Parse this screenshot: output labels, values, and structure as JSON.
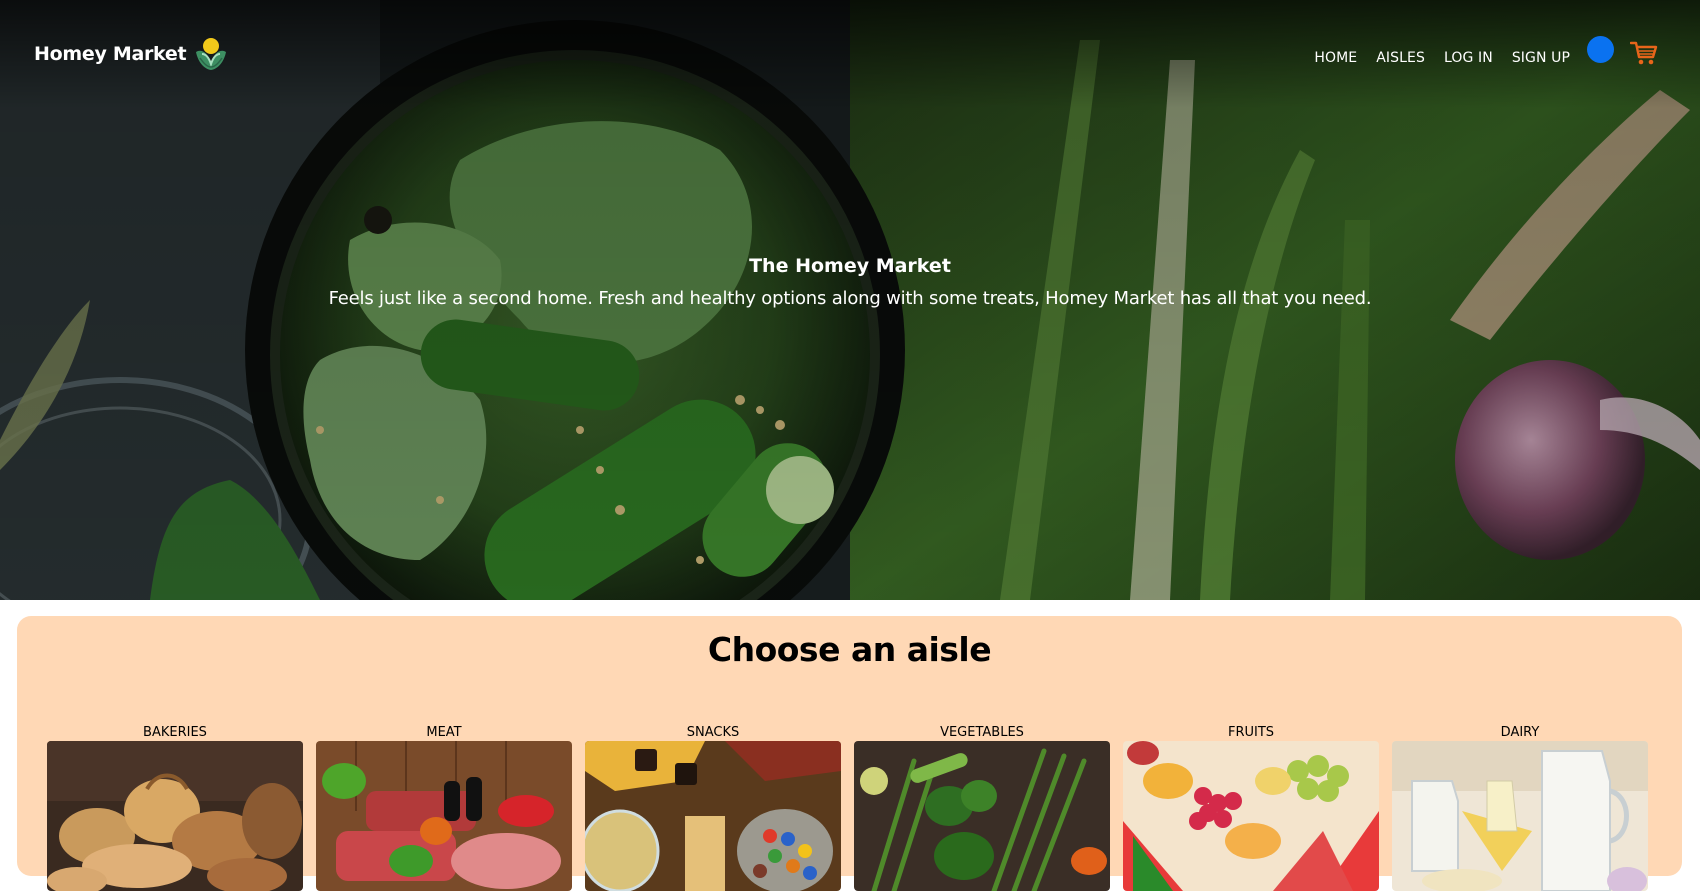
{
  "brand": {
    "name": "Homey Market",
    "logo_icon": "leaf-hands-logo-icon"
  },
  "nav": {
    "links": [
      {
        "label": "HOME"
      },
      {
        "label": "AISLES"
      },
      {
        "label": "LOG IN"
      },
      {
        "label": "SIGN UP"
      }
    ],
    "avatar_color": "#0a72f0",
    "cart_icon": "cart-icon",
    "cart_color": "#e8651a"
  },
  "hero": {
    "title": "The Homey Market",
    "subtitle": "Feels just like a second home. Fresh and healthy options along with some treats, Homey Market has all that you need."
  },
  "aisles": {
    "heading": "Choose an aisle",
    "panel_color": "#ffd8b5",
    "items": [
      {
        "label": "BAKERIES"
      },
      {
        "label": "MEAT"
      },
      {
        "label": "SNACKS"
      },
      {
        "label": "VEGETABLES"
      },
      {
        "label": "FRUITS"
      },
      {
        "label": "DAIRY"
      }
    ]
  }
}
